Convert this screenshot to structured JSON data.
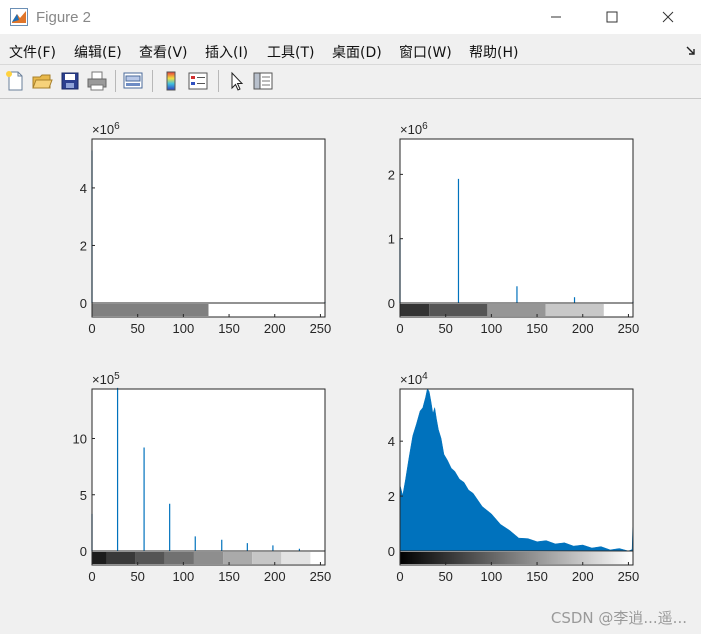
{
  "window": {
    "title": "Figure 2"
  },
  "menu": [
    {
      "label": "文件(F)"
    },
    {
      "label": "编辑(E)"
    },
    {
      "label": "查看(V)"
    },
    {
      "label": "插入(I)"
    },
    {
      "label": "工具(T)"
    },
    {
      "label": "桌面(D)"
    },
    {
      "label": "窗口(W)"
    },
    {
      "label": "帮助(H)"
    }
  ],
  "toolbar": {
    "icons": [
      "new-figure-icon",
      "open-file-icon",
      "save-icon",
      "print-icon",
      "link-plot-icon",
      "insert-colorbar-icon",
      "insert-legend-icon",
      "edit-plot-cursor-icon",
      "property-inspector-icon"
    ]
  },
  "colors": {
    "series": "#0072bd"
  },
  "watermark": "CSDN @李逍...遥...",
  "chart_data": [
    {
      "type": "bar",
      "title": "",
      "exponent_label": "×10^6",
      "xlim": [
        0,
        255
      ],
      "ylim": [
        0,
        5.7
      ],
      "xticks": [
        0,
        50,
        100,
        150,
        200,
        250
      ],
      "yticks": [
        0,
        2,
        4
      ],
      "x": [
        0,
        128,
        255
      ],
      "values": [
        5.3,
        0.001,
        0.04
      ],
      "colorbar": {
        "levels": 2,
        "grays": [
          "#808080",
          "#ffffff"
        ]
      }
    },
    {
      "type": "bar",
      "title": "",
      "exponent_label": "×10^6",
      "xlim": [
        0,
        255
      ],
      "ylim": [
        0,
        2.55
      ],
      "xticks": [
        0,
        50,
        100,
        150,
        200,
        250
      ],
      "yticks": [
        0,
        1,
        2
      ],
      "x": [
        0,
        64,
        128,
        191,
        255
      ],
      "values": [
        1.0,
        1.93,
        0.26,
        0.09,
        0.02
      ],
      "colorbar": {
        "levels": 5,
        "grays": [
          "#333333",
          "#555555",
          "#969696",
          "#c8c8c8",
          "#ffffff"
        ]
      }
    },
    {
      "type": "bar",
      "title": "",
      "exponent_label": "×10^5",
      "xlim": [
        0,
        255
      ],
      "ylim": [
        0,
        14.4
      ],
      "xticks": [
        0,
        50,
        100,
        150,
        200,
        250
      ],
      "yticks": [
        0,
        5,
        10
      ],
      "x": [
        0,
        28,
        57,
        85,
        113,
        142,
        170,
        198,
        227,
        255
      ],
      "values": [
        3.3,
        14.5,
        9.2,
        4.2,
        1.3,
        1.0,
        0.7,
        0.5,
        0.2,
        0.05
      ],
      "colorbar": {
        "levels": 9,
        "grays": [
          "#1c1c1c",
          "#393939",
          "#555555",
          "#717171",
          "#8e8e8e",
          "#aaaaaa",
          "#c6c6c6",
          "#e3e3e3",
          "#ffffff"
        ]
      }
    },
    {
      "type": "area",
      "title": "",
      "exponent_label": "×10^4",
      "xlim": [
        0,
        255
      ],
      "ylim": [
        0,
        5.9
      ],
      "xticks": [
        0,
        50,
        100,
        150,
        200,
        250
      ],
      "yticks": [
        0,
        2,
        4
      ],
      "x": [
        0,
        3,
        6,
        10,
        14,
        18,
        22,
        25,
        28,
        30,
        32,
        34,
        36,
        38,
        40,
        42,
        45,
        48,
        52,
        56,
        60,
        65,
        70,
        75,
        80,
        90,
        100,
        110,
        120,
        130,
        140,
        150,
        160,
        170,
        180,
        190,
        200,
        210,
        220,
        230,
        240,
        250,
        254,
        255
      ],
      "values": [
        2.4,
        2.1,
        2.6,
        3.5,
        4.2,
        4.7,
        5.1,
        5.3,
        5.6,
        6.0,
        5.8,
        5.5,
        5.0,
        5.3,
        4.8,
        4.5,
        4.1,
        3.6,
        3.3,
        3.1,
        2.9,
        2.7,
        2.5,
        2.3,
        2.1,
        1.7,
        1.35,
        1.05,
        0.75,
        0.55,
        0.45,
        0.42,
        0.38,
        0.34,
        0.3,
        0.26,
        0.22,
        0.19,
        0.16,
        0.12,
        0.09,
        0.06,
        0.05,
        1.3
      ],
      "colorbar": {
        "levels": 256,
        "grays": [
          "#000000",
          "#ffffff"
        ]
      }
    }
  ]
}
